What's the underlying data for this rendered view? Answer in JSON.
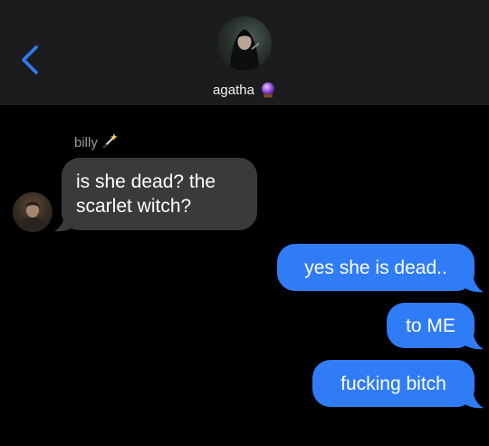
{
  "header": {
    "contact_name": "agatha",
    "contact_emoji": "crystal-ball-icon",
    "back_icon": "chevron-left-icon"
  },
  "thread": {
    "incoming_sender": "billy",
    "incoming_sender_emoji": "magic-wand-icon",
    "incoming": [
      {
        "text": "is she dead? the scarlet witch?"
      }
    ],
    "outgoing": [
      {
        "text": "yes she is dead.."
      },
      {
        "text": "to ME"
      },
      {
        "text": "fucking bitch"
      }
    ]
  },
  "colors": {
    "background": "#000000",
    "header": "#1c1c1e",
    "incoming_bubble": "#3a3a3c",
    "outgoing_bubble": "#2f7cf6",
    "accent": "#2f7cf6",
    "sender_label": "#9a9a9f"
  }
}
